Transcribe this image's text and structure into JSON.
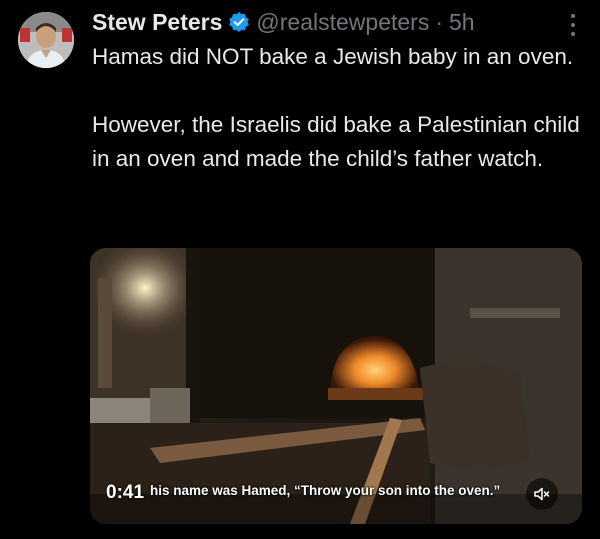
{
  "tweet": {
    "author": {
      "display_name": "Stew Peters",
      "handle": "@realstewpeters",
      "verified": true,
      "avatar_icon": "profile-photo"
    },
    "separator": "·",
    "time": "5h",
    "more_icon": "more-vertical-icon",
    "paragraphs": [
      "Hamas did NOT bake a Jewish baby in an oven.",
      "However, the Israelis did bake a Palestinian child in an oven and made the child’s father watch."
    ],
    "video": {
      "timestamp": "0:41",
      "subtitle": "his name was Hamed, “Throw your son into the oven.”",
      "mute_icon": "volume-muted-icon"
    }
  },
  "colors": {
    "background": "#000000",
    "text_primary": "#e7e9ea",
    "text_secondary": "#71767b",
    "verified_badge": "#1d9bf0"
  }
}
